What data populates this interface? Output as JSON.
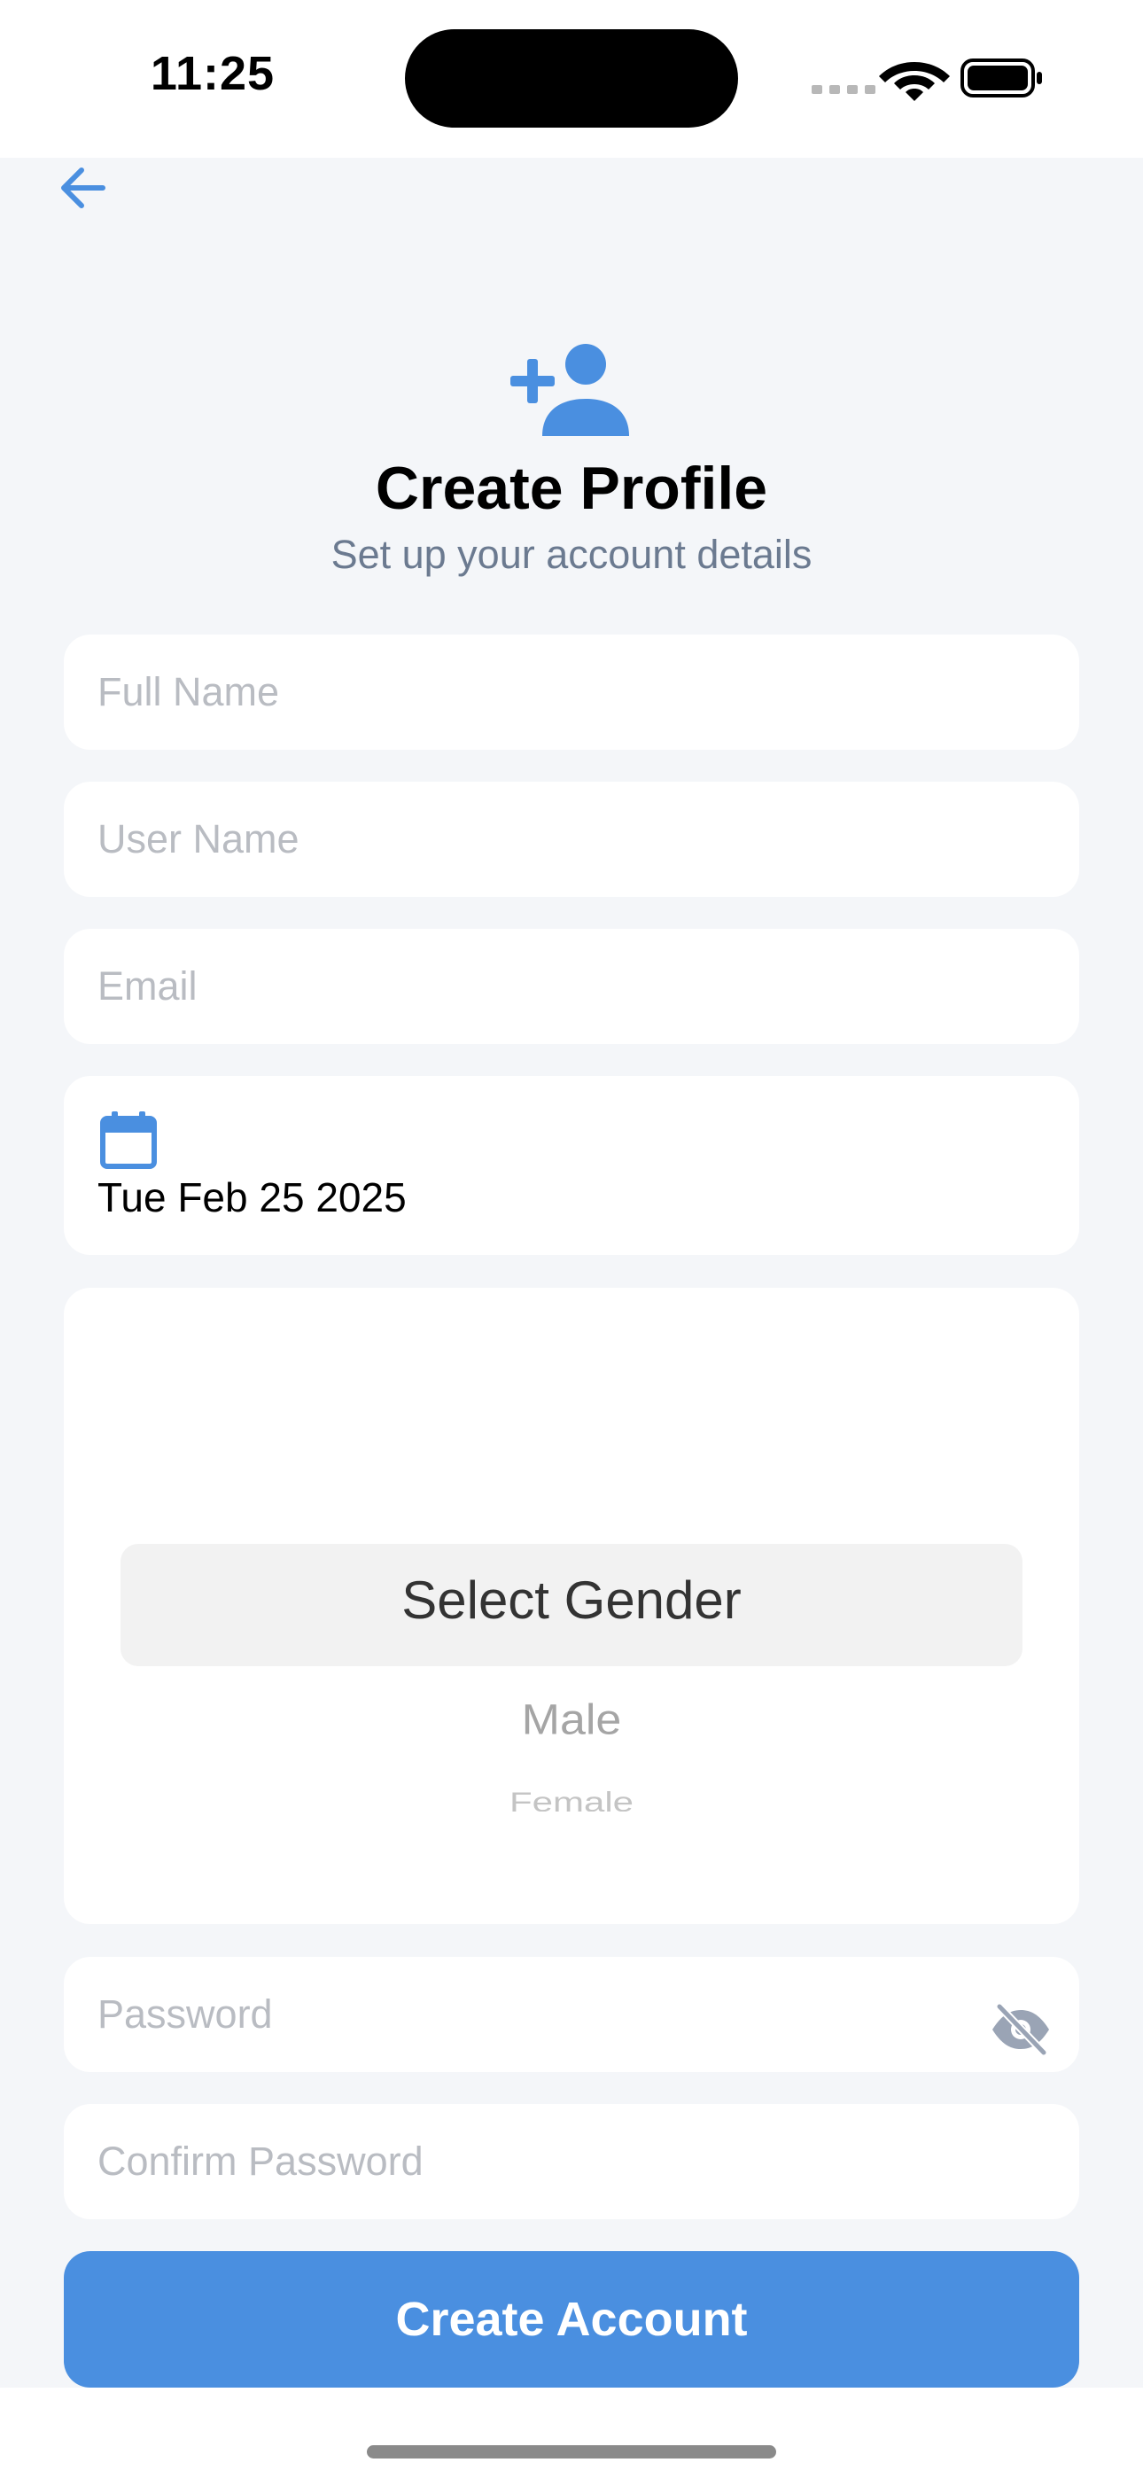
{
  "status_bar": {
    "time": "11:25"
  },
  "header": {
    "back_icon": "arrow-left-icon",
    "icon": "person-add-icon",
    "title": "Create Profile",
    "subtitle": "Set up your account details"
  },
  "form": {
    "full_name": {
      "placeholder": "Full Name",
      "value": ""
    },
    "user_name": {
      "placeholder": "User Name",
      "value": ""
    },
    "email": {
      "placeholder": "Email",
      "value": ""
    },
    "date": {
      "icon": "calendar-icon",
      "value": "Tue Feb 25 2025"
    },
    "gender_picker": {
      "selected": "Select Gender",
      "options": [
        "Male",
        "Female"
      ]
    },
    "password": {
      "placeholder": "Password",
      "value": "",
      "toggle_icon": "eye-off-icon"
    },
    "confirm_password": {
      "placeholder": "Confirm Password",
      "value": ""
    }
  },
  "actions": {
    "create_account_label": "Create Account"
  },
  "colors": {
    "accent": "#4A8FE0",
    "background": "#F4F6F9",
    "subtitle": "#6B7A90",
    "placeholder": "#B9BCC2"
  }
}
